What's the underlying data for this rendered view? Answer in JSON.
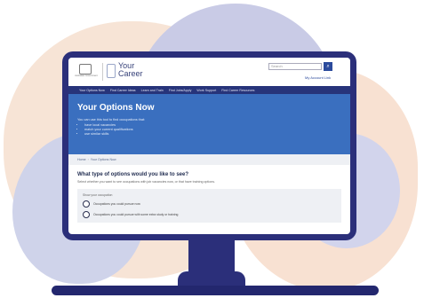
{
  "header": {
    "gov_text": "Australian Government",
    "brand_line1": "Your",
    "brand_line2": "Career",
    "search_placeholder": "Search",
    "search_icon": "search-icon",
    "account_link": "My Account Link"
  },
  "nav": {
    "items": [
      "Your Options Now",
      "Find Career Ideas",
      "Learn and Train",
      "Find Jobs/Apply",
      "Work Support",
      "Find Career Resources"
    ]
  },
  "hero": {
    "title": "Your Options Now",
    "intro": "You can use this tool to find occupations that:",
    "bullets": [
      "have local vacancies",
      "match your current qualifications",
      "use similar skills"
    ]
  },
  "breadcrumb": [
    "Home",
    "Your Options Now"
  ],
  "main": {
    "question": "What type of options would you like to see?",
    "help": "Select whether you want to see occupations with job vacancies now, or that have training options.",
    "panel_label": "Show your occupation",
    "options": [
      "Occupations you could pursue now",
      "Occupations you could pursue with some extra study or training"
    ]
  },
  "colors": {
    "monitor_frame": "#2b2f7a",
    "nav_bg": "#27347a",
    "hero_bg": "#3a6fbf",
    "accent_peach": "#f7e4d6",
    "accent_lavender": "#c9cbe6"
  }
}
